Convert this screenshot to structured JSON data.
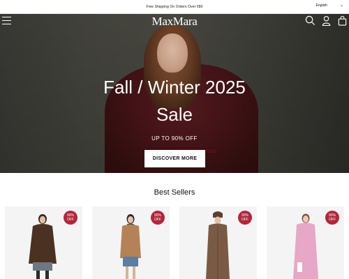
{
  "announcement": {
    "text": "Free Shipping On Orders Over €80",
    "language": "English"
  },
  "header": {
    "logo": "MaxMara",
    "icons": [
      "menu-icon",
      "search-icon",
      "account-icon",
      "bag-icon"
    ]
  },
  "hero": {
    "title_line1": "Fall / Winter 2025",
    "title_line2": "Sale",
    "subtitle": "UP TO 90% OFF",
    "cta_label": "DISCOVER MORE"
  },
  "best_sellers": {
    "title": "Best Sellers",
    "products": [
      {
        "badge_line1": "90%",
        "badge_line2": "OFF",
        "coat_color": "#4a3121",
        "skirt_color": "#6e7783"
      },
      {
        "badge_line1": "90%",
        "badge_line2": "OFF",
        "coat_color": "#b58257",
        "skirt_color": "#5d7ea0"
      },
      {
        "badge_line1": "90%",
        "badge_line2": "OFF",
        "coat_color": "#7a5a44",
        "skirt_color": "#7a5a44"
      },
      {
        "badge_line1": "90%",
        "badge_line2": "OFF",
        "coat_color": "#e7a7c6",
        "skirt_color": "#e7a7c6"
      }
    ]
  },
  "colors": {
    "badge": "#b3263a",
    "hero_coat": "#4a1519"
  }
}
